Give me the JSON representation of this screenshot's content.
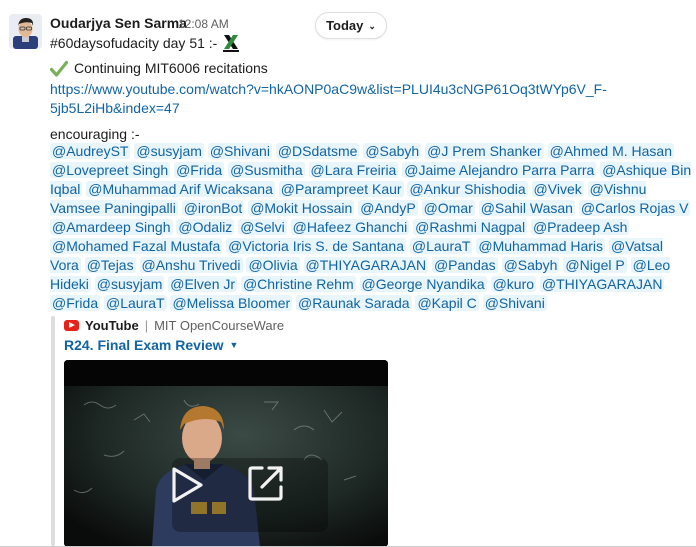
{
  "message": {
    "author": "Oudarjya Sen Sarma",
    "time": "12:08 AM",
    "day_divider": "Today",
    "line1": "#60daysofudacity day 51 :-",
    "line2": "Continuing MIT6006 recitations",
    "link": "https://www.youtube.com/watch?v=hkAONP0aC9w&list=PLUI4u3cNGP61Oq3tWYp6V_F-5jb5L2iHb&index=47",
    "encouraging": "encouraging :-",
    "mentions": [
      "@AudreyST",
      "@susyjam",
      "@Shivani",
      "@DSdatsme",
      "@Sabyh",
      "@J Prem Shanker",
      "@Ahmed M. Hasan",
      "@Lovepreet Singh",
      "@Frida",
      "@Susmitha",
      "@Lara Freiria",
      "@Jaime Alejandro Parra Parra",
      "@Ashique Bin Iqbal",
      "@Muhammad Arif Wicaksana",
      "@Parampreet Kaur",
      "@Ankur Shishodia",
      "@Vivek",
      "@Vishnu Vamsee Paningipalli",
      "@ironBot",
      "@Mokit Hossain",
      "@AndyP",
      "@Omar",
      "@Sahil Wasan",
      "@Carlos Rojas V",
      "@Amardeep Singh",
      "@Odaliz",
      "@Selvi",
      "@Hafeez Ghanchi",
      "@Rashmi Nagpal",
      "@Pradeep Ash",
      "@Mohamed Fazal Mustafa",
      "@Victoria Iris S. de Santana",
      "@LauraT",
      "@Muhammad Haris",
      "@Vatsal Vora",
      "@Tejas",
      "@Anshu Trivedi",
      "@Olivia",
      "@THIYAGARAJAN",
      "@Pandas",
      "@Sabyh",
      "@Nigel P",
      "@Leo Hideki",
      "@susyjam",
      "@Elven Jr",
      "@Christine Rehm",
      "@George Nyandika",
      "@kuro",
      "@THIYAGARAJAN",
      "@Frida",
      "@LauraT",
      "@Melissa Bloomer",
      "@Raunak Sarada",
      "@Kapil C",
      "@Shivani"
    ]
  },
  "unfurl": {
    "service": "YouTube",
    "separator": "|",
    "channel": "MIT OpenCourseWare",
    "title": "R24. Final Exam Review",
    "icons": [
      "youtube-logo-icon",
      "caret-down-icon",
      "play-icon",
      "external-link-icon"
    ]
  },
  "colors": {
    "link": "#1264a3",
    "mention_bg": "#e8f5fa",
    "youtube_red": "#e62117",
    "check_green": "#78b159"
  }
}
